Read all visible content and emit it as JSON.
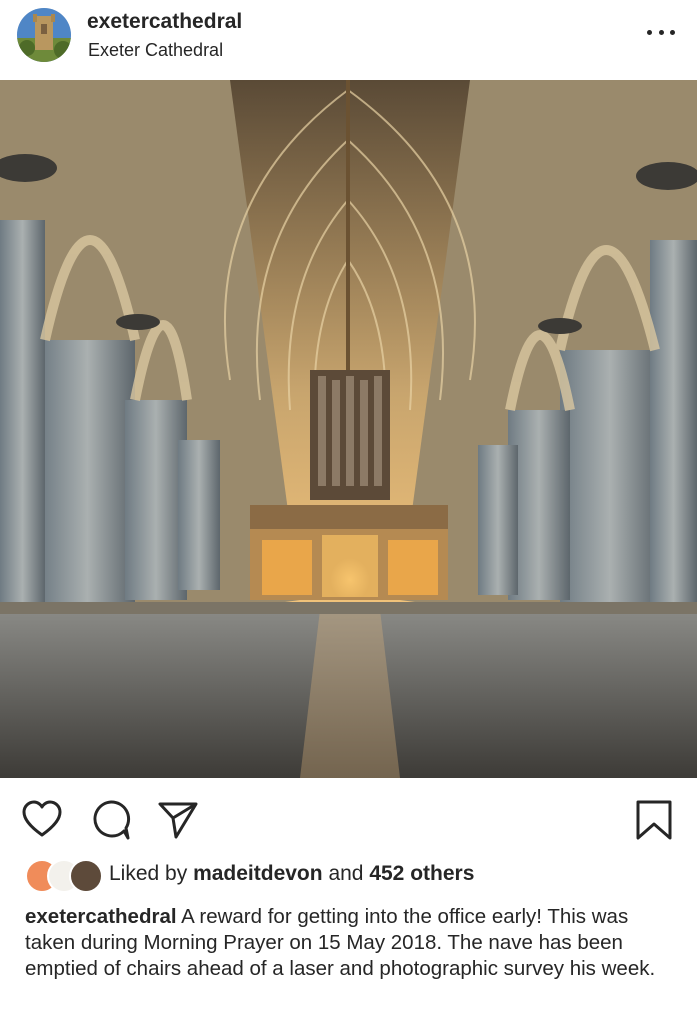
{
  "post": {
    "username": "exetercathedral",
    "location": "Exeter Cathedral",
    "liked_by_prefix": "Liked by",
    "liked_by_user": "madeitdevon",
    "liked_by_and": "and",
    "liked_by_others": "452 others",
    "caption_user": "exetercathedral",
    "caption_text": "A reward for getting into the office early! This was taken during Morning Prayer on 15 May 2018. The nave has been emptied of chairs ahead of a laser and photographic survey his week."
  },
  "icons": {
    "more": "more-options-icon",
    "like": "heart-icon",
    "comment": "comment-icon",
    "share": "share-icon",
    "save": "bookmark-icon"
  },
  "colors": {
    "text": "#262626",
    "stone": "#c9b89a",
    "warm_light": "#f2b24a"
  }
}
